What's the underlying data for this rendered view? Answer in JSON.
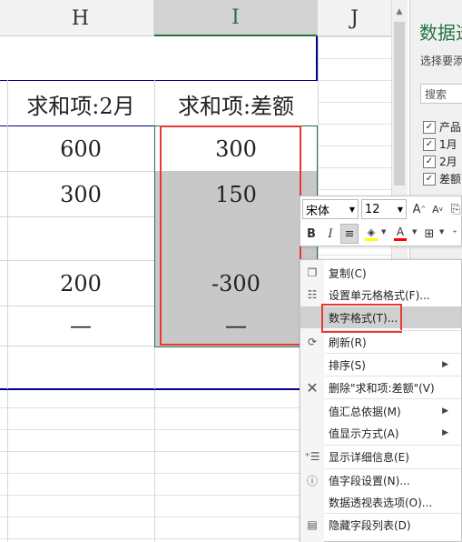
{
  "columns": {
    "h": "H",
    "i": "I",
    "j": "J"
  },
  "pivot": {
    "header_h": "求和项:2月",
    "header_i": "求和项:差额",
    "rows": [
      {
        "h": "600",
        "i": "300"
      },
      {
        "h": "300",
        "i": "150"
      },
      {
        "h": "",
        "i": ""
      },
      {
        "h": "200",
        "i": "-300"
      },
      {
        "h": "—",
        "i": "—"
      }
    ]
  },
  "field_pane": {
    "title": "数据透",
    "subtitle": "选择要添",
    "search_placeholder": "搜索",
    "fields": [
      {
        "label": "产品",
        "checked": true
      },
      {
        "label": "1月",
        "checked": true
      },
      {
        "label": "2月",
        "checked": true
      },
      {
        "label": "差额",
        "checked": true
      }
    ]
  },
  "mini_toolbar": {
    "font_name": "宋体",
    "font_size": "12",
    "grow_font": "A",
    "shrink_font": "A",
    "bold": "B",
    "italic": "I",
    "font_color_label": "A",
    "font_color": "#ff0000",
    "highlight_color": "#ffff00"
  },
  "context_menu": {
    "items": [
      {
        "label": "复制(C)",
        "icon": "copy-icon",
        "submenu": false
      },
      {
        "label": "设置单元格格式(F)...",
        "icon": "format-cells-icon",
        "submenu": false
      },
      {
        "label": "数字格式(T)...",
        "icon": "",
        "submenu": false,
        "highlighted": true
      },
      {
        "label": "刷新(R)",
        "icon": "refresh-icon",
        "submenu": false
      },
      {
        "label": "排序(S)",
        "icon": "",
        "submenu": true
      },
      {
        "label": "删除\"求和项:差额\"(V)",
        "icon": "delete-x-icon",
        "submenu": false
      },
      {
        "label": "值汇总依据(M)",
        "icon": "",
        "submenu": true
      },
      {
        "label": "值显示方式(A)",
        "icon": "",
        "submenu": true
      },
      {
        "label": "显示详细信息(E)",
        "icon": "show-details-icon",
        "submenu": false
      },
      {
        "label": "值字段设置(N)...",
        "icon": "field-settings-icon",
        "submenu": false
      },
      {
        "label": "数据透视表选项(O)...",
        "icon": "",
        "submenu": false
      },
      {
        "label": "隐藏字段列表(D)",
        "icon": "field-list-icon",
        "submenu": false
      }
    ]
  },
  "colors": {
    "excel_green": "#217346",
    "pivot_border": "#00008b",
    "red_highlight": "#e53935",
    "selection_gray": "#c8c8c8"
  }
}
